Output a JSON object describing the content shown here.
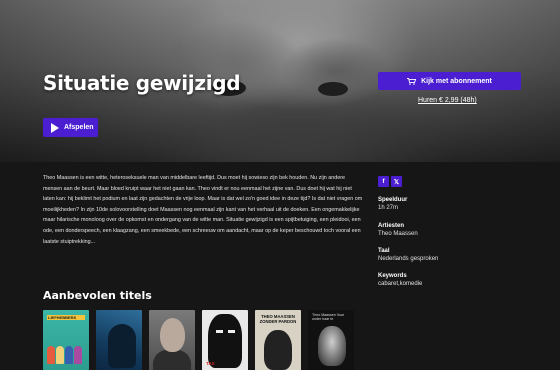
{
  "hero": {
    "title": "Situatie gewijzigd",
    "play_label": "Afspelen",
    "subscribe_label": "Kijk met abonnement",
    "rent_label": "Huren € 2,99 (48h)"
  },
  "description": "Theo Maassen is een witte, heteroseksuele man van middelbare leeftijd. Dus moet hij sowieso zijn bek houden. Nu zijn andere mensen aan de beurt. Maar bloed kruipt waar het niet gaan kan. Theo vindt er nou eenmaal het zijne van. Dus doet hij wat hij niet laten kan: hij beklimt het podium en laat zijn gedachten de vrije loop. Maar is dat wel zo'n goed idee in deze tijd? Is dat niet vragen om moeilijkheden? In zijn 10de solovoorstelling doet Maassen nog eenmaal zijn kant van het verhaal uit de doeken. Een ongemakkelijke maar hilarische monoloog over de opkomst en ondergang van de witte man. Situatie gewijzigd is een spijtbetuiging, een pleidooi, een ode, een donderspeech, een klaagzang, een smeekbede, een schreeuw om aandacht, maar op de keper beschouwd toch vooral een laatste stuiptrekking...",
  "share": {
    "facebook": "f",
    "x": "𝕏"
  },
  "meta": {
    "duration_label": "Speelduur",
    "duration_value": "1h 27m",
    "artists_label": "Artiesten",
    "artists_value": "Theo Maassen",
    "language_label": "Taal",
    "language_value": "Nederlands gesproken",
    "keywords_label": "Keywords",
    "keywords_value": "cabaret,komedie"
  },
  "recommended": {
    "title": "Aanbevolen titels",
    "posters": [
      {
        "text": "LIEFHEBBERS"
      },
      {
        "text": ""
      },
      {
        "text": ""
      },
      {
        "text": "TAX"
      },
      {
        "text": "THEO MAASSEN ZONDER PARDON"
      },
      {
        "text": "Theo Maassen Vuur onder haar te"
      }
    ]
  },
  "colors": {
    "accent": "#4b1fd1",
    "background": "#161616"
  }
}
